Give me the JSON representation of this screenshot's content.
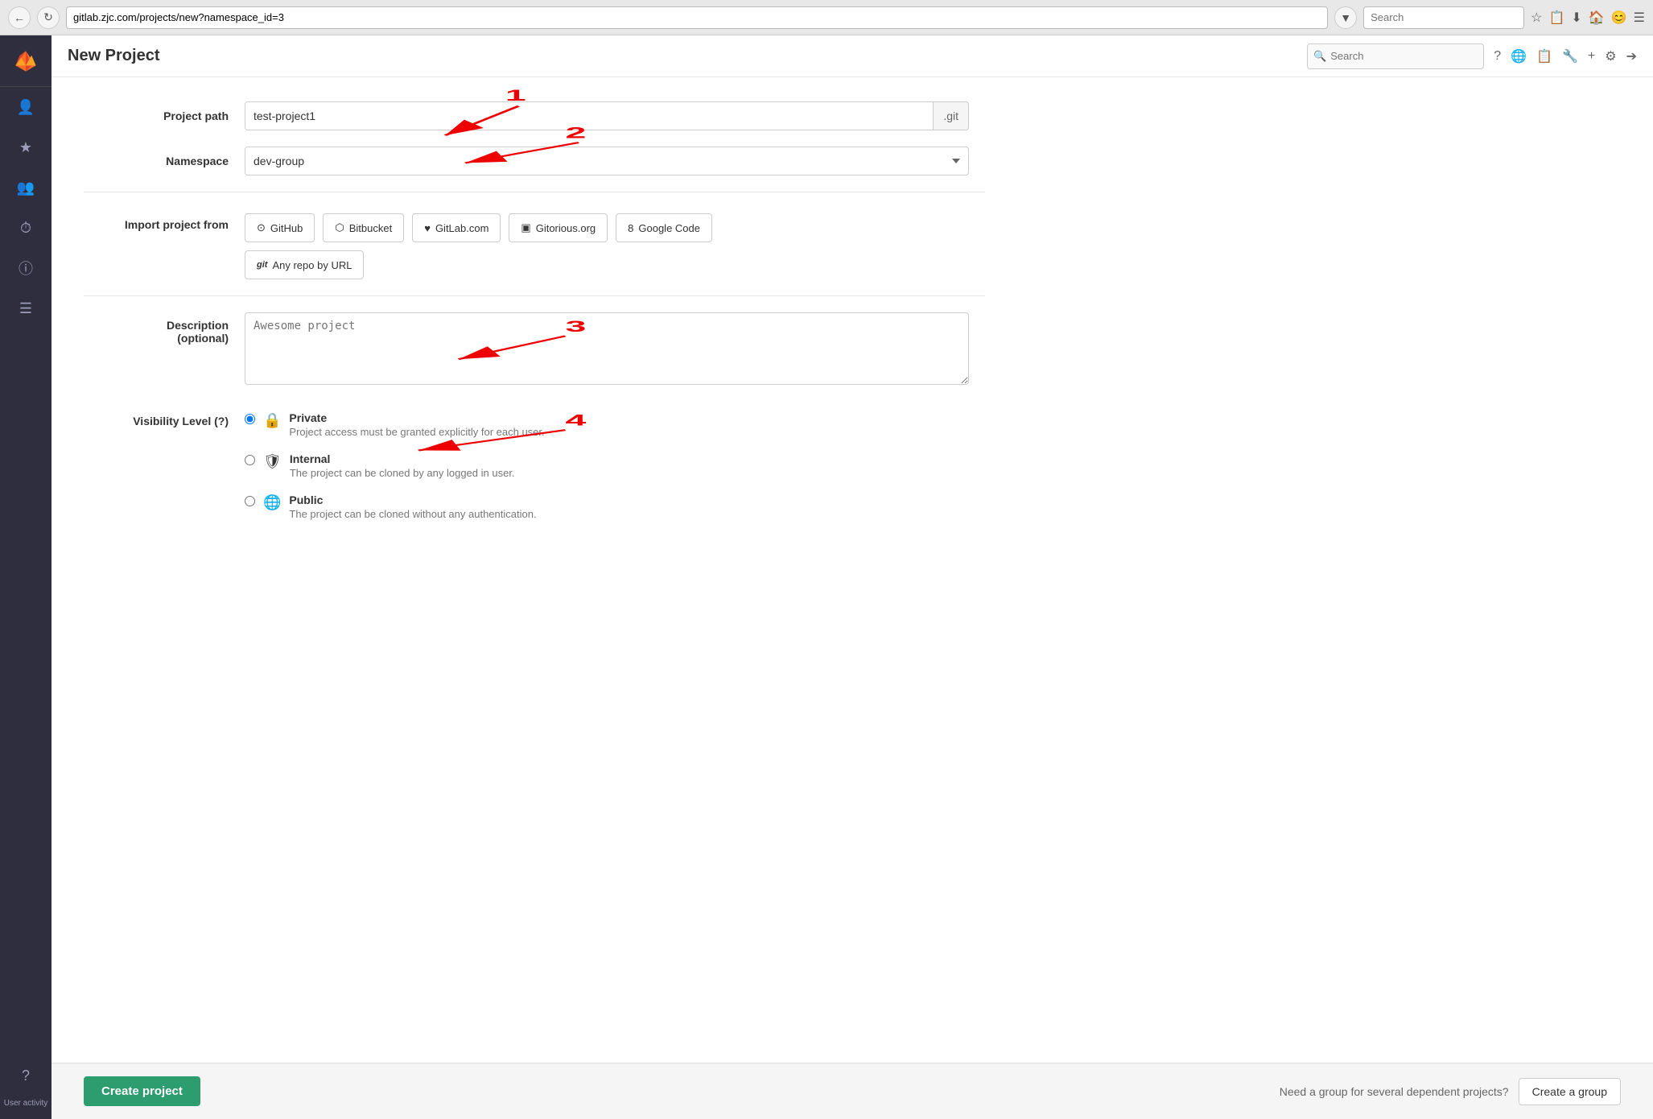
{
  "browser": {
    "url": "gitlab.zjc.com/projects/new?namespace_id=3",
    "search_placeholder": "Search"
  },
  "header": {
    "title": "New Project",
    "search_placeholder": "Search"
  },
  "sidebar": {
    "items": [
      {
        "icon": "🦊",
        "name": "logo"
      },
      {
        "icon": "👤",
        "name": "user-icon"
      },
      {
        "icon": "★",
        "name": "star-icon"
      },
      {
        "icon": "👥",
        "name": "groups-icon"
      },
      {
        "icon": "⏱",
        "name": "clock-icon"
      },
      {
        "icon": "ℹ",
        "name": "info-icon"
      },
      {
        "icon": "≡",
        "name": "menu-icon"
      },
      {
        "icon": "?",
        "name": "help-icon"
      }
    ],
    "user_label": "User activity"
  },
  "form": {
    "project_path_label": "Project path",
    "project_path_value": "test-project1",
    "project_path_suffix": ".git",
    "namespace_label": "Namespace",
    "namespace_value": "dev-group",
    "import_label": "Import project from",
    "import_buttons": [
      {
        "icon": "⬤",
        "label": "GitHub"
      },
      {
        "icon": "⬤",
        "label": "Bitbucket"
      },
      {
        "icon": "♥",
        "label": "GitLab.com"
      },
      {
        "icon": "▣",
        "label": "Gitorious.org"
      },
      {
        "icon": "8",
        "label": "Google Code"
      },
      {
        "icon": "git",
        "label": "Any repo by URL"
      }
    ],
    "description_label": "Description\n(optional)",
    "description_placeholder": "Awesome project",
    "visibility_label": "Visibility Level (?)",
    "visibility_options": [
      {
        "value": "private",
        "icon": "🔒",
        "title": "Private",
        "desc": "Project access must be granted explicitly for each user.",
        "checked": true
      },
      {
        "value": "internal",
        "icon": "🛡",
        "title": "Internal",
        "desc": "The project can be cloned by any logged in user.",
        "checked": false
      },
      {
        "value": "public",
        "icon": "🌐",
        "title": "Public",
        "desc": "The project can be cloned without any authentication.",
        "checked": false
      }
    ]
  },
  "footer": {
    "create_project_btn": "Create project",
    "group_prompt": "Need a group for several dependent projects?",
    "create_group_btn": "Create a group"
  },
  "annotations": {
    "num1": "1",
    "num2": "2",
    "num3": "3",
    "num4": "4"
  }
}
